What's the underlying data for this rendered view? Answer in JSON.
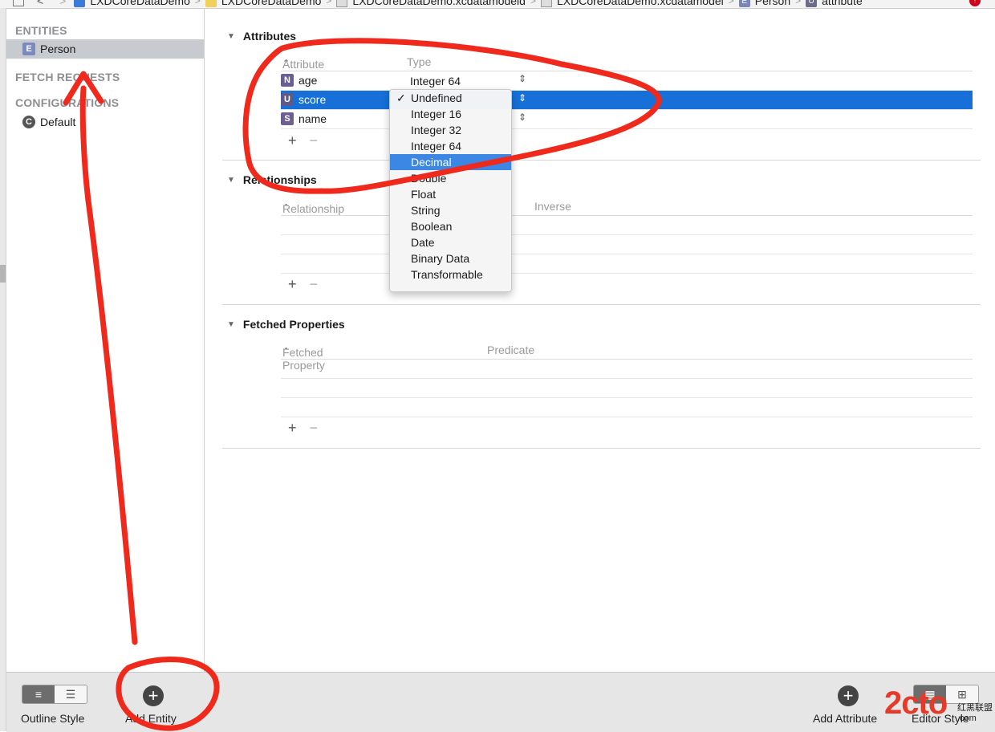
{
  "breadcrumb": [
    {
      "label": "LXDCoreDataDemo",
      "icon": "project-icon"
    },
    {
      "label": "LXDCoreDataDemo",
      "icon": "folder-icon"
    },
    {
      "label": "LXDCoreDataDemo.xcdatamodeld",
      "icon": "file-icon"
    },
    {
      "label": "LXDCoreDataDemo.xcdatamodel",
      "icon": "file-icon"
    },
    {
      "label": "Person",
      "icon": "entity-icon",
      "badge": "E"
    },
    {
      "label": "attribute",
      "icon": "attribute-icon",
      "badge": "U"
    }
  ],
  "sidebar": {
    "entities_heading": "ENTITIES",
    "entities": [
      {
        "badge": "E",
        "label": "Person"
      }
    ],
    "fetch_heading": "FETCH REQUESTS",
    "config_heading": "CONFIGURATIONS",
    "configurations": [
      {
        "badge": "C",
        "label": "Default"
      }
    ]
  },
  "attributes": {
    "heading": "Attributes",
    "col_attribute": "Attribute",
    "col_type": "Type",
    "rows": [
      {
        "badge": "N",
        "name": "age",
        "type": "Integer 64"
      },
      {
        "badge": "U",
        "name": "score",
        "type": ""
      },
      {
        "badge": "S",
        "name": "name",
        "type": ""
      }
    ]
  },
  "dropdown": {
    "selected": "Undefined",
    "highlighted": "Decimal",
    "options": [
      "Undefined",
      "Integer 16",
      "Integer 32",
      "Integer 64",
      "Decimal",
      "Double",
      "Float",
      "String",
      "Boolean",
      "Date",
      "Binary Data",
      "Transformable"
    ]
  },
  "relationships": {
    "heading": "Relationships",
    "col_relationship": "Relationship",
    "col_inverse": "Inverse"
  },
  "fetched": {
    "heading": "Fetched Properties",
    "col_fetched": "Fetched Property",
    "col_predicate": "Predicate"
  },
  "bottom": {
    "outline_label": "Outline Style",
    "add_entity_label": "Add Entity",
    "add_attribute_label": "Add Attribute",
    "editor_label": "Editor Style"
  },
  "symbols": {
    "plus": "+",
    "minus": "−",
    "sort": "⌃",
    "stepper": "⇕",
    "check": "✓",
    "triangle": "▼"
  },
  "watermark": {
    "main": "2cto",
    "sub": "红黑联盟",
    "suffix": ".com"
  },
  "colors": {
    "selection": "#1670d8",
    "highlight": "#3b87e3",
    "annotation": "#f0291d"
  }
}
